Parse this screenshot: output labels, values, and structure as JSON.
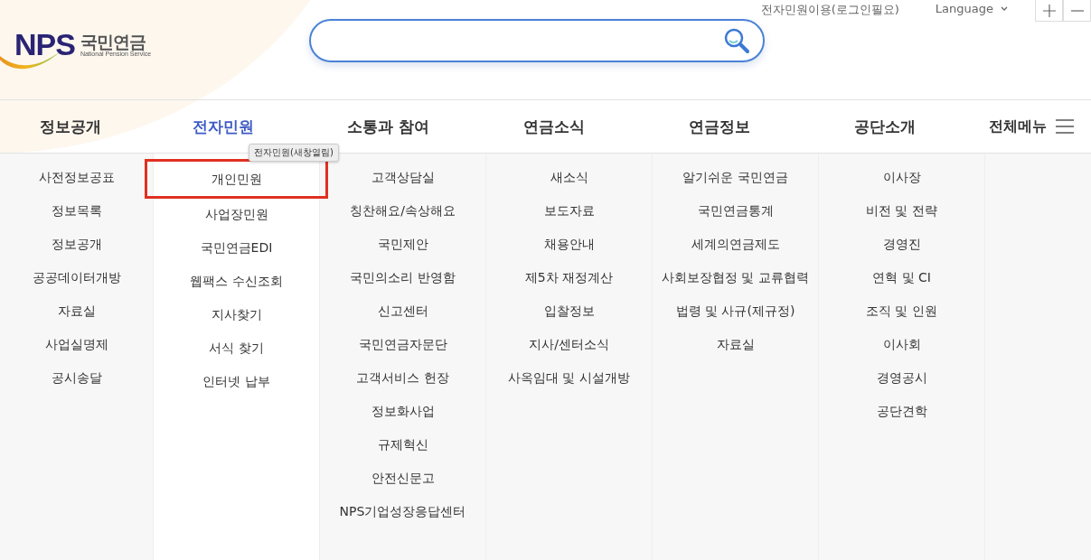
{
  "utility_links": [
    {
      "label": "전자민원이용(로그인필요)",
      "kind": "link"
    },
    {
      "label": "Language",
      "kind": "dropdown"
    }
  ],
  "logo": {
    "mark": "NPS",
    "name": "국민연금",
    "subtitle": "National Pension Service"
  },
  "nav": [
    {
      "label": "정보공개",
      "selected": false,
      "items": [
        {
          "label": "사전정보공표",
          "selected": false
        },
        {
          "label": "정보목록",
          "selected": false
        },
        {
          "label": "정보공개",
          "selected": false
        },
        {
          "label": "공공데이터개방",
          "selected": false
        },
        {
          "label": "자료실",
          "selected": false
        },
        {
          "label": "사업실명제",
          "selected": false
        },
        {
          "label": "공시송달",
          "selected": false
        }
      ]
    },
    {
      "label": "전자민원",
      "selected": true,
      "tooltip": "전자민원(새창열림)",
      "items": [
        {
          "label": "개인민원",
          "selected": true
        },
        {
          "label": "사업장민원",
          "selected": false
        },
        {
          "label": "국민연금EDI",
          "selected": false
        },
        {
          "label": "웹팩스 수신조회",
          "selected": false
        },
        {
          "label": "지사찾기",
          "selected": false
        },
        {
          "label": "서식 찾기",
          "selected": false
        },
        {
          "label": "인터넷 납부",
          "selected": false
        }
      ]
    },
    {
      "label": "소통과 참여",
      "selected": false,
      "items": [
        {
          "label": "고객상담실",
          "selected": false
        },
        {
          "label": "칭찬해요/속상해요",
          "selected": false
        },
        {
          "label": "국민제안",
          "selected": false
        },
        {
          "label": "국민의소리 반영함",
          "selected": false
        },
        {
          "label": "신고센터",
          "selected": false
        },
        {
          "label": "국민연금자문단",
          "selected": false
        },
        {
          "label": "고객서비스 헌장",
          "selected": false
        },
        {
          "label": "정보화사업",
          "selected": false
        },
        {
          "label": "규제혁신",
          "selected": false
        },
        {
          "label": "안전신문고",
          "selected": false
        },
        {
          "label": "NPS기업성장응답센터",
          "selected": false
        }
      ]
    },
    {
      "label": "연금소식",
      "selected": false,
      "items": [
        {
          "label": "새소식",
          "selected": false
        },
        {
          "label": "보도자료",
          "selected": false
        },
        {
          "label": "채용안내",
          "selected": false
        },
        {
          "label": "제5차 재정계산",
          "selected": false
        },
        {
          "label": "입찰정보",
          "selected": false
        },
        {
          "label": "지사/센터소식",
          "selected": false
        },
        {
          "label": "사옥임대 및 시설개방",
          "selected": false
        }
      ]
    },
    {
      "label": "연금정보",
      "selected": false,
      "items": [
        {
          "label": "알기쉬운 국민연금",
          "selected": false
        },
        {
          "label": "국민연금통계",
          "selected": false
        },
        {
          "label": "세계의연금제도",
          "selected": false
        },
        {
          "label": "사회보장협정 및 교류협력",
          "selected": false
        },
        {
          "label": "법령 및 사규(제규정)",
          "selected": false
        },
        {
          "label": "자료실",
          "selected": false
        }
      ]
    },
    {
      "label": "공단소개",
      "selected": false,
      "items": [
        {
          "label": "이사장",
          "selected": false
        },
        {
          "label": "비전 및 전략",
          "selected": false
        },
        {
          "label": "경영진",
          "selected": false
        },
        {
          "label": "연혁 및 CI",
          "selected": false
        },
        {
          "label": "조직 및 인원",
          "selected": false
        },
        {
          "label": "이사회",
          "selected": false
        },
        {
          "label": "경영공시",
          "selected": false
        },
        {
          "label": "공단견학",
          "selected": false
        }
      ]
    }
  ],
  "all_menu": {
    "label": "전체메뉴"
  }
}
